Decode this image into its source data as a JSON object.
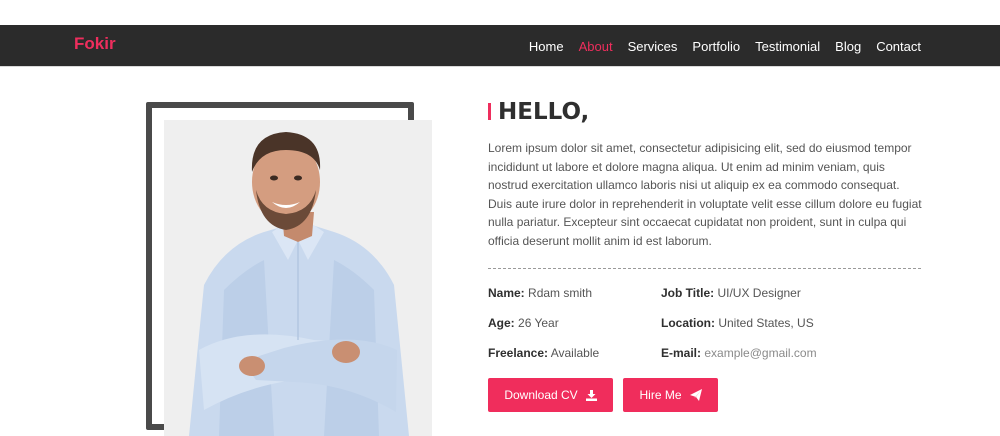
{
  "brand": "Fokir",
  "nav": [
    {
      "label": "Home",
      "active": false
    },
    {
      "label": "About",
      "active": true
    },
    {
      "label": "Services",
      "active": false
    },
    {
      "label": "Portfolio",
      "active": false
    },
    {
      "label": "Testimonial",
      "active": false
    },
    {
      "label": "Blog",
      "active": false
    },
    {
      "label": "Contact",
      "active": false
    }
  ],
  "about": {
    "heading": "HELLO,",
    "intro": "Lorem ipsum dolor sit amet, consectetur adipisicing elit, sed do eiusmod tempor incididunt ut labore et dolore magna aliqua. Ut enim ad minim veniam, quis nostrud exercitation ullamco laboris nisi ut aliquip ex ea commodo consequat. Duis aute irure dolor in reprehenderit in voluptate velit esse cillum dolore eu fugiat nulla pariatur. Excepteur sint occaecat cupidatat non proident, sunt in culpa qui officia deserunt mollit anim id est laborum.",
    "info": {
      "name_label": "Name:",
      "name_value": "Rdam smith",
      "job_label": "Job Title:",
      "job_value": "UI/UX Designer",
      "age_label": "Age:",
      "age_value": "26 Year",
      "location_label": "Location:",
      "location_value": "United States, US",
      "freelance_label": "Freelance:",
      "freelance_value": "Available",
      "email_label": "E-mail:",
      "email_value": "example@gmail.com"
    },
    "buttons": {
      "download": "Download CV",
      "hire": "Hire Me"
    }
  },
  "colors": {
    "accent": "#ee2e5d",
    "navbar": "#2b2b2b",
    "frame": "#4a4a4a"
  },
  "icons": {
    "download": "download-icon",
    "hire": "paper-plane-icon"
  }
}
